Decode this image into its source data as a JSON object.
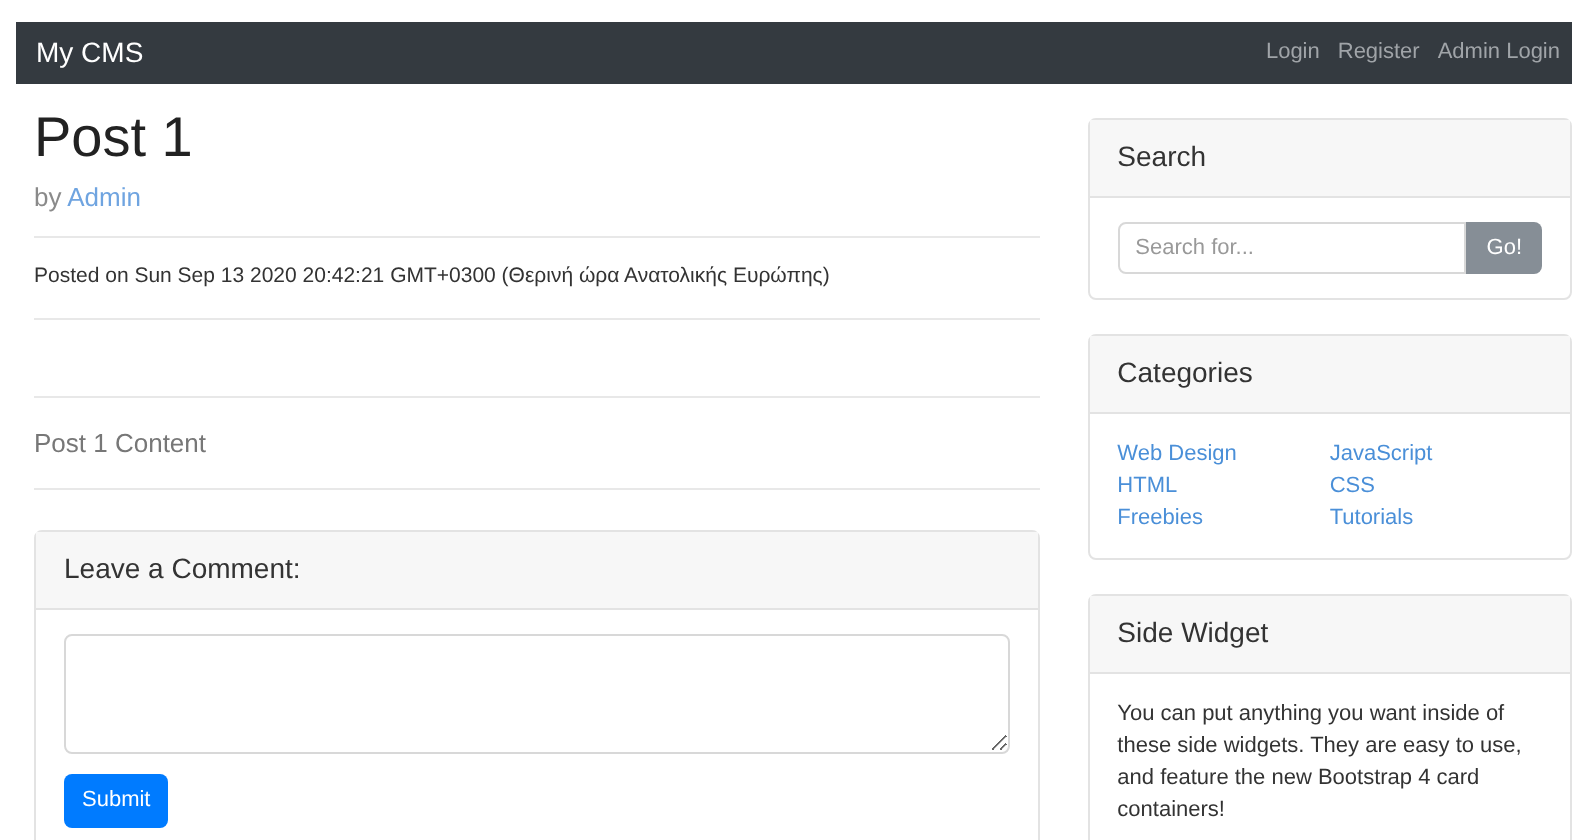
{
  "navbar": {
    "brand": "My CMS",
    "links": [
      "Login",
      "Register",
      "Admin Login"
    ]
  },
  "post": {
    "title": "Post 1",
    "by": "by",
    "author": "Admin",
    "posted": "Posted on Sun Sep 13 2020 20:42:21 GMT+0300 (Θερινή ώρα Ανατολικής Ευρώπης)",
    "content": "Post 1 Content"
  },
  "comment": {
    "title": "Leave a Comment:",
    "button": "Submit"
  },
  "search": {
    "title": "Search",
    "placeholder": "Search for...",
    "button": "Go!"
  },
  "categories": {
    "title": "Categories",
    "columns": [
      [
        "Web Design",
        "HTML",
        "Freebies"
      ],
      [
        "JavaScript",
        "CSS",
        "Tutorials"
      ]
    ]
  },
  "side_widget": {
    "title": "Side Widget",
    "text": "You can put anything you want inside of these side widgets. They are easy to use, and feature the new Bootstrap 4 card containers!"
  }
}
